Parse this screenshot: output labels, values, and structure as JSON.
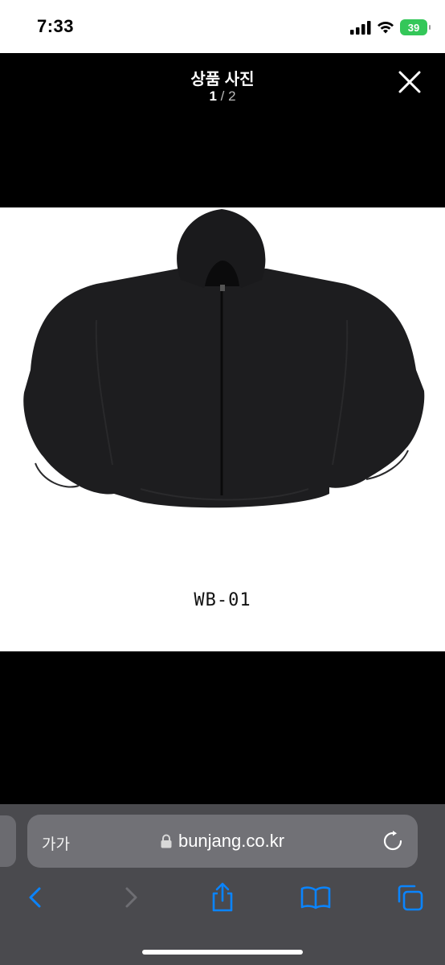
{
  "status_bar": {
    "time": "7:33",
    "battery": "39"
  },
  "viewer": {
    "title": "상품 사진",
    "counter_current": "1",
    "counter_separator": " / ",
    "counter_total": "2"
  },
  "photo": {
    "product_label": "WB-01"
  },
  "browser": {
    "text_size_label": "가가",
    "url": "bunjang.co.kr"
  },
  "icons": {
    "close": "close-icon",
    "lock": "lock-icon",
    "reload": "reload-icon",
    "back": "chevron-left-icon",
    "forward": "chevron-right-icon",
    "share": "share-icon",
    "bookmarks": "book-icon",
    "tabs": "tabs-icon",
    "signal": "signal-icon",
    "wifi": "wifi-icon"
  },
  "colors": {
    "accent": "#0a84ff",
    "battery": "#34c759",
    "toolbar_bg": "#4a4a4e"
  }
}
